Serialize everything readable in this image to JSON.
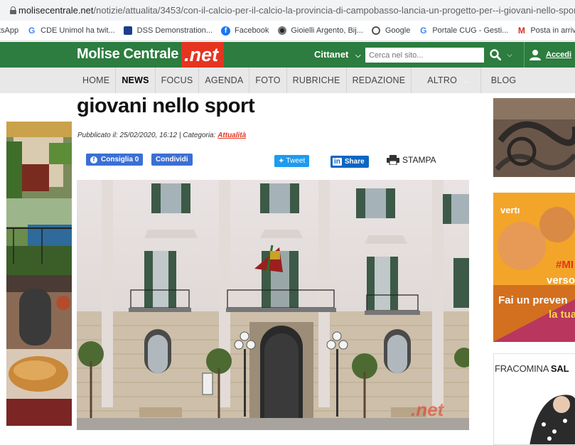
{
  "browser": {
    "url_host": "molisecentrale.net",
    "url_path": "/notizie/attualita/3453/con-il-calcio-per-il-calcio-la-provincia-di-campobasso-lancia-un-progetto-per--i-giovani-nello-sport-",
    "bookmarks": [
      {
        "label": "tsApp",
        "icon": ""
      },
      {
        "label": "CDE Unimol ha twit...",
        "icon": "google-icon"
      },
      {
        "label": "DSS Demonstration...",
        "icon": "dss-icon"
      },
      {
        "label": "Facebook",
        "icon": "facebook-icon"
      },
      {
        "label": "Gioielli Argento, Bij...",
        "icon": "jewelry-icon"
      },
      {
        "label": "Google",
        "icon": "globe-icon"
      },
      {
        "label": "Portale CUG - Gesti...",
        "icon": "google-icon"
      },
      {
        "label": "Posta in arrivo",
        "icon": "gmail-icon"
      }
    ]
  },
  "site": {
    "logo_part1": "Molise",
    "logo_part2": "Centrale",
    "logo_net": ".net",
    "cittanet_label": "Cittanet",
    "search_placeholder": "Cerca nel sito...",
    "login_label": "Accedi",
    "brand_green": "#2c7d3f",
    "brand_red": "#e53420"
  },
  "nav": {
    "items": [
      "HOME",
      "NEWS",
      "FOCUS",
      "AGENDA",
      "FOTO",
      "RUBRICHE",
      "REDAZIONE",
      "ALTRO",
      "BLOG"
    ],
    "active": "NEWS"
  },
  "article": {
    "title": "giovani nello sport",
    "published_prefix": "Pubblicato il: 25/02/2020, 16:12 | Categoria: ",
    "category": "Attualità"
  },
  "share": {
    "consiglia": "Consiglia 0",
    "condividi": "Condividi",
    "tweet": "Tweet",
    "linkedin": "Share",
    "stampa": "STAMPA"
  },
  "photo": {
    "watermark": ".net"
  },
  "sidebar": {
    "ad_brand": "vertı",
    "ad_line1": "#MI",
    "ad_line2": "verso",
    "ad_line3": "Fai un preven",
    "ad_line4": "la tua",
    "fraco_brand": "FRACOMINA",
    "fraco_word": "SAL"
  }
}
